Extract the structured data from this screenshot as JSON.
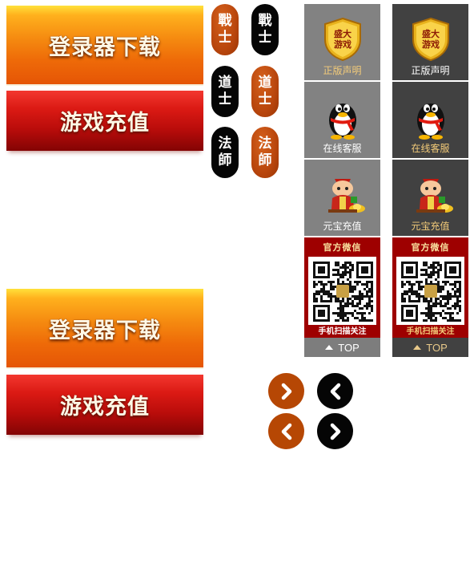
{
  "buttons": {
    "download_label": "登录器下载",
    "recharge_label": "游戏充值"
  },
  "badges": {
    "warrior": [
      "戰",
      "士"
    ],
    "taoist": [
      "道",
      "士"
    ],
    "mage": [
      "法",
      "師"
    ]
  },
  "side_panel": {
    "notice_label": "正版声明",
    "service_label": "在线客服",
    "recharge_label": "元宝充值",
    "shield_text": [
      "盛大",
      "游戏"
    ],
    "wechat_title": "官方微信",
    "wechat_caption": "手机扫描关注",
    "top_label": "TOP"
  },
  "colors": {
    "orange": "#b64704",
    "black": "#050505",
    "panel_light": "#828282",
    "panel_dark": "#414141",
    "gold_text": "#f3cb79",
    "wechat_red": "#9e0000"
  },
  "icons": {
    "arrow_right": "chevron-right-icon",
    "arrow_left": "chevron-left-icon",
    "top": "triangle-up-icon",
    "shield": "shield-icon",
    "penguin": "qq-penguin-icon",
    "mascot": "ingot-mascot-icon",
    "qr": "qr-code"
  }
}
